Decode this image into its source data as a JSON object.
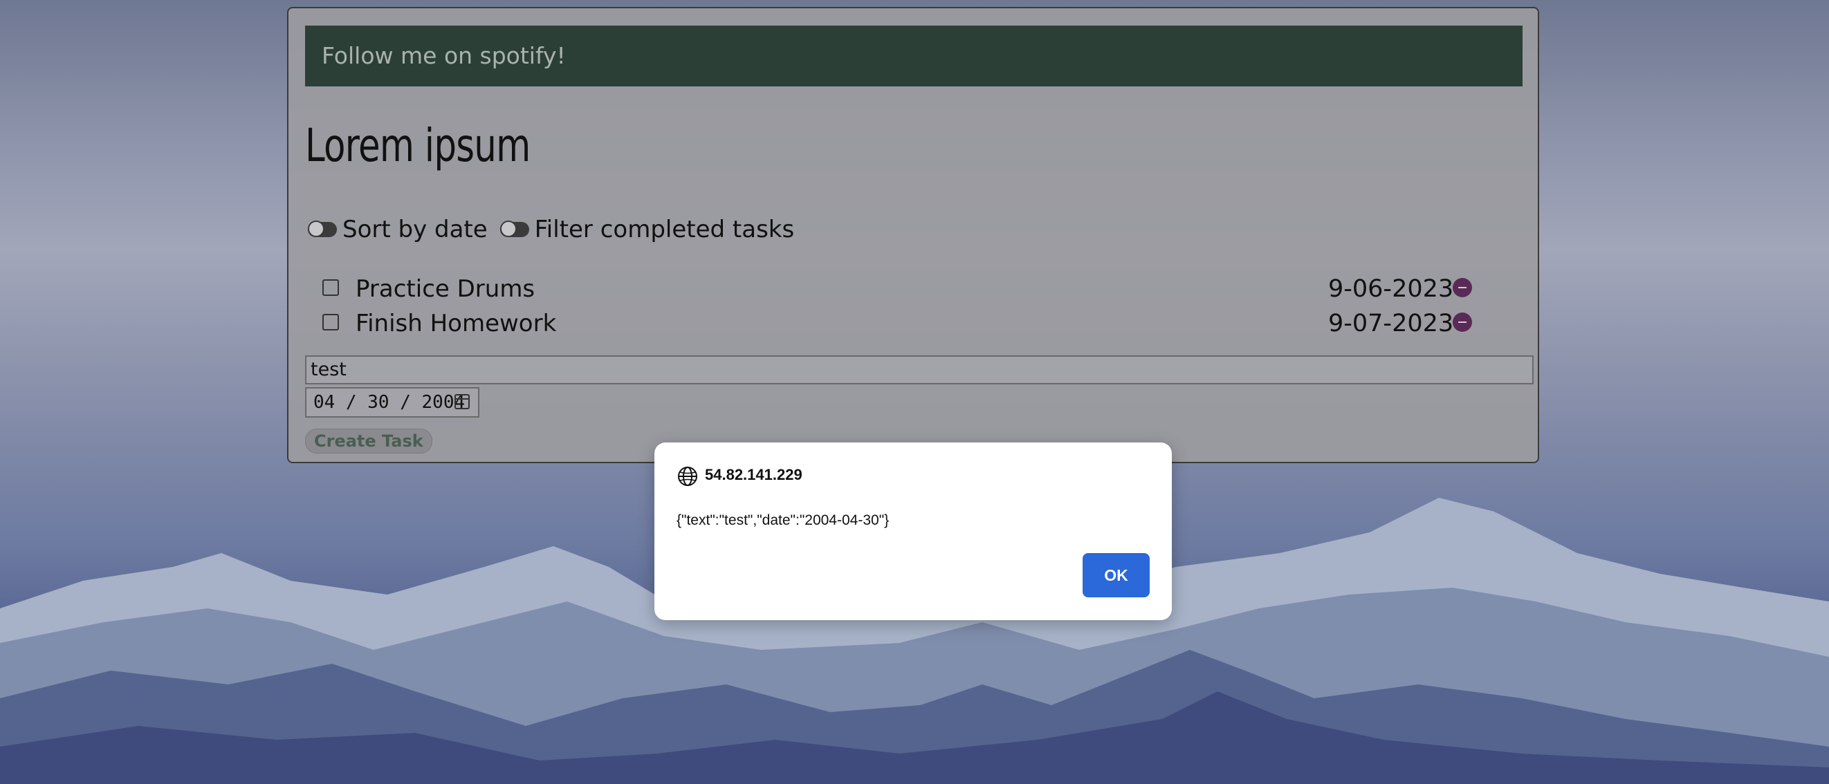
{
  "banner": {
    "text": "Follow me on spotify!"
  },
  "page": {
    "title": "Lorem ipsum"
  },
  "controls": {
    "sort_label": "Sort by date",
    "filter_label": "Filter completed tasks"
  },
  "tasks": [
    {
      "text": "Practice Drums",
      "date": "9-06-2023",
      "completed": false
    },
    {
      "text": "Finish Homework",
      "date": "9-07-2023",
      "completed": false
    }
  ],
  "form": {
    "task_text_value": "test",
    "date_value": "04 / 30 / 2004",
    "create_label": "Create Task"
  },
  "dialog": {
    "origin": "54.82.141.229",
    "message": "{\"text\":\"test\",\"date\":\"2004-04-30\"}",
    "ok_label": "OK"
  },
  "colors": {
    "banner_bg": "#2c3f37",
    "delete_button": "#5a2a57",
    "ok_button": "#2b68d9"
  },
  "icons": {
    "globe": "globe-icon",
    "calendar": "calendar-icon",
    "delete": "minus-circle-icon"
  }
}
